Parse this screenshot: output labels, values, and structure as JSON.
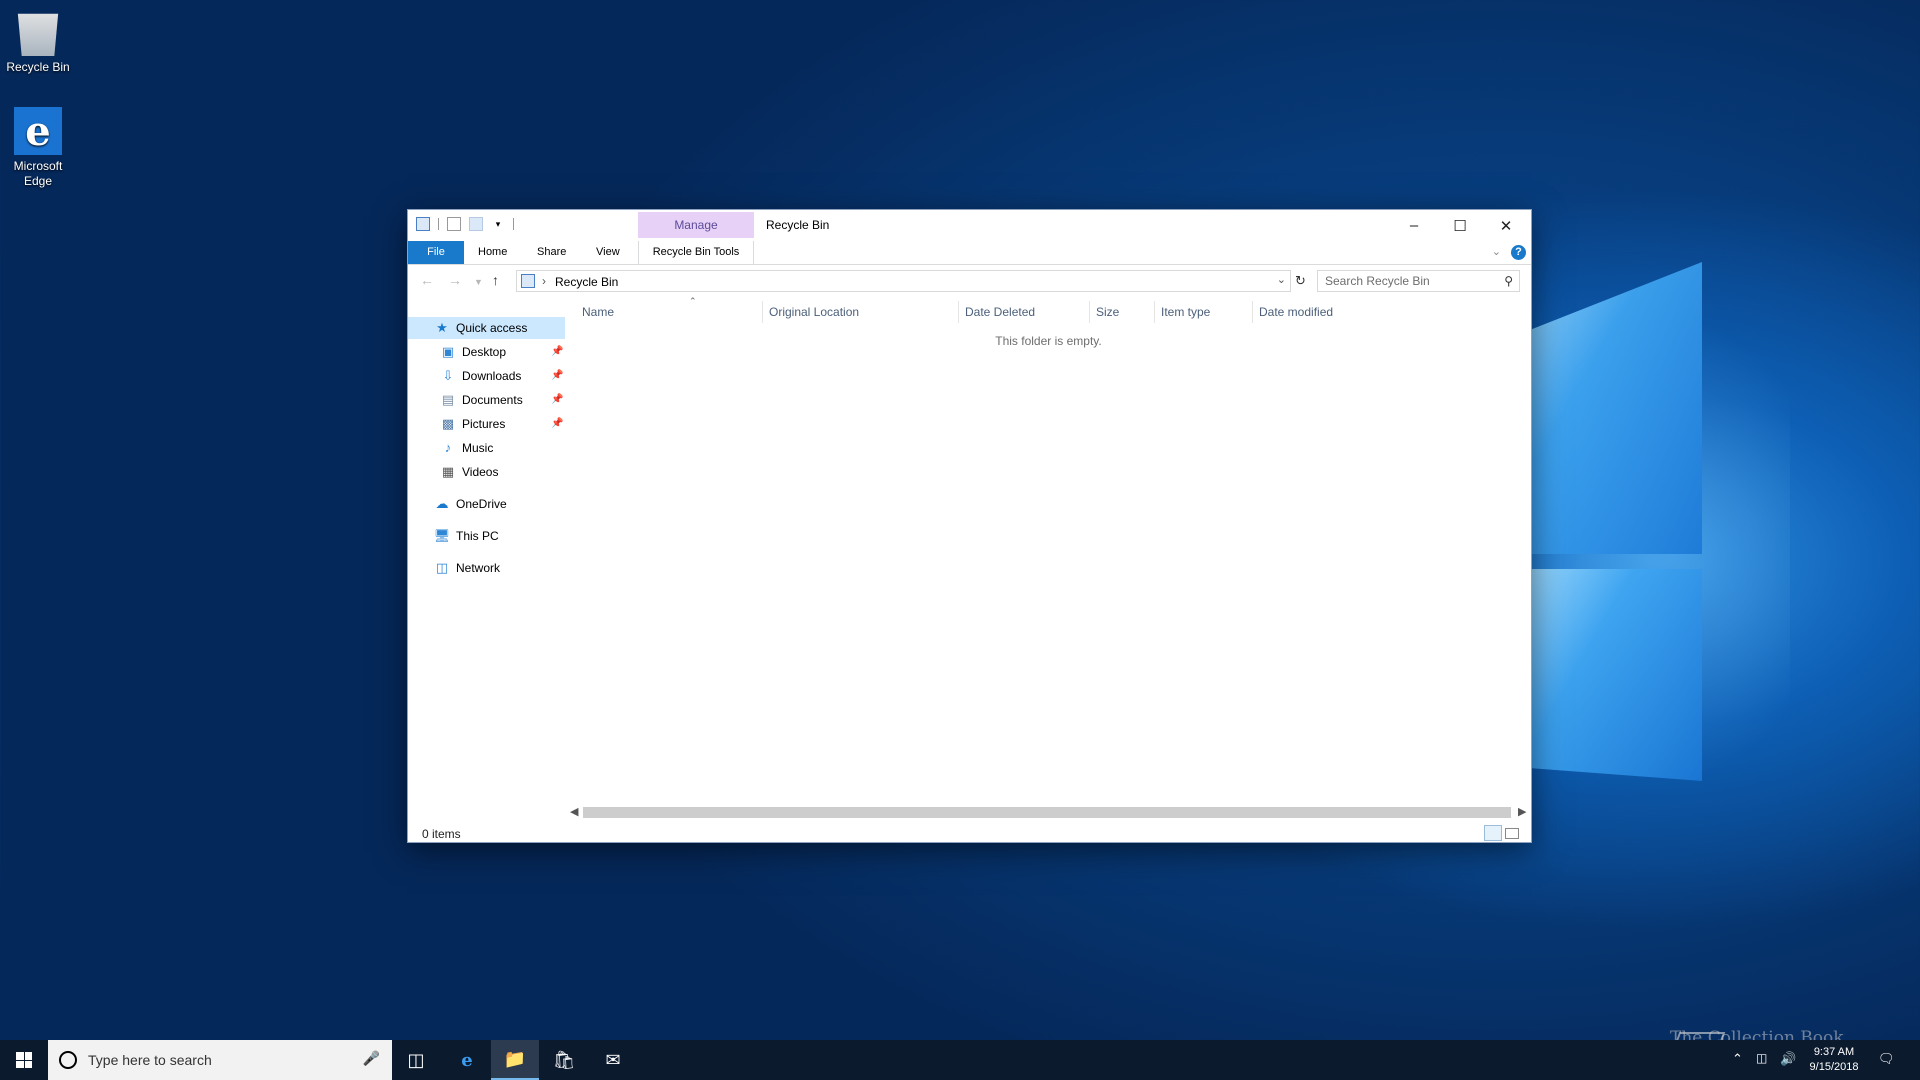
{
  "desktop": {
    "icons": [
      {
        "label": "Recycle Bin"
      },
      {
        "label": "Microsoft Edge"
      }
    ]
  },
  "window": {
    "title": "Recycle Bin",
    "contextual_tab_group": "Manage",
    "ribbon_tabs": [
      "File",
      "Home",
      "Share",
      "View",
      "Recycle Bin Tools"
    ],
    "address": {
      "crumb": "Recycle Bin"
    },
    "search": {
      "placeholder": "Search Recycle Bin"
    },
    "nav_pane": {
      "quick_access": "Quick access",
      "pinned": [
        {
          "label": "Desktop",
          "icon": "desktop-icon"
        },
        {
          "label": "Downloads",
          "icon": "downloads-icon"
        },
        {
          "label": "Documents",
          "icon": "documents-icon"
        },
        {
          "label": "Pictures",
          "icon": "pictures-icon"
        }
      ],
      "unpinned": [
        {
          "label": "Music",
          "icon": "music-icon"
        },
        {
          "label": "Videos",
          "icon": "videos-icon"
        }
      ],
      "onedrive": "OneDrive",
      "this_pc": "This PC",
      "network": "Network"
    },
    "columns": [
      "Name",
      "Original Location",
      "Date Deleted",
      "Size",
      "Item type",
      "Date modified"
    ],
    "empty_message": "This folder is empty.",
    "status": {
      "item_count": "0 items"
    }
  },
  "taskbar": {
    "search_placeholder": "Type here to search",
    "clock": {
      "time": "9:37 AM",
      "date": "9/15/2018"
    }
  },
  "watermark": "The Collection Book",
  "colors": {
    "accent": "#1979ca",
    "manage_tab": "#e8d1f6",
    "selection": "#cce8ff"
  }
}
